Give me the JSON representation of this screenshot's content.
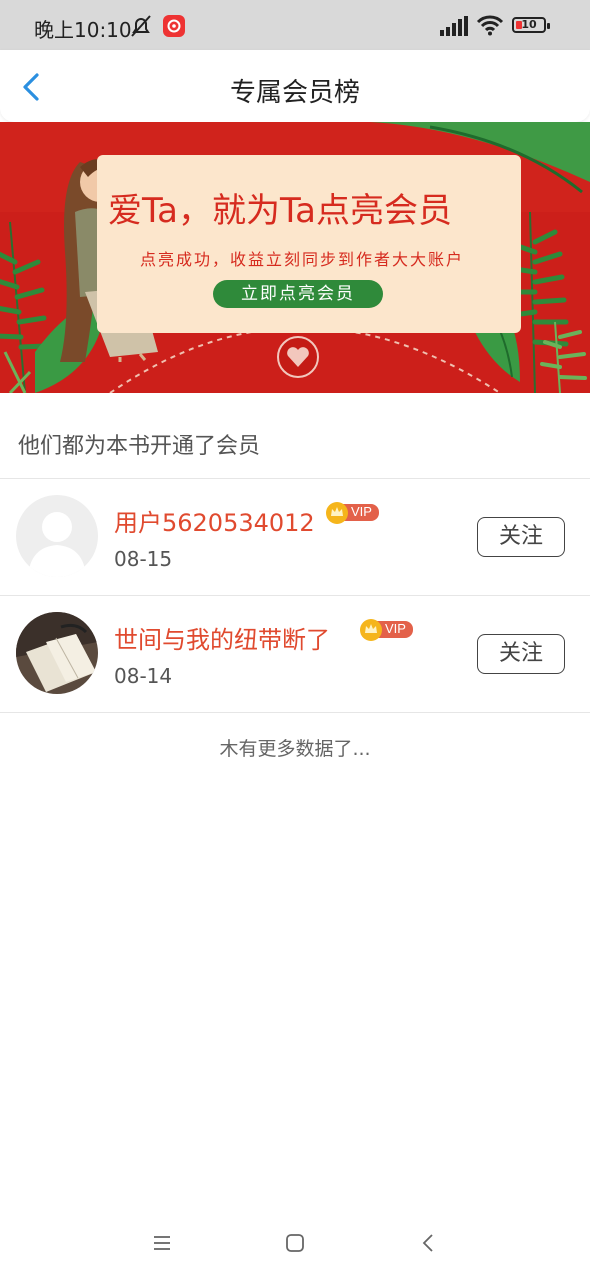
{
  "status_bar": {
    "time": "晚上10:10",
    "battery": "10"
  },
  "header": {
    "title": "专属会员榜"
  },
  "banner": {
    "title": "爱Ta，就为Ta点亮会员",
    "subtitle": "点亮成功，收益立刻同步到作者大大账户",
    "button_label": "立即点亮会员"
  },
  "section": {
    "title": "他们都为本书开通了会员"
  },
  "members": [
    {
      "name": "用户5620534012",
      "date": "08-15",
      "badge": "VIP",
      "follow_label": "关注"
    },
    {
      "name": "世间与我的纽带断了",
      "date": "08-14",
      "badge": "VIP",
      "follow_label": "关注"
    }
  ],
  "footer": {
    "no_more": "木有更多数据了..."
  },
  "colors": {
    "accent": "#e04a2f",
    "banner_red": "#cc1f1a",
    "banner_green": "#2f8a3a",
    "back_blue": "#2b8fe0"
  }
}
